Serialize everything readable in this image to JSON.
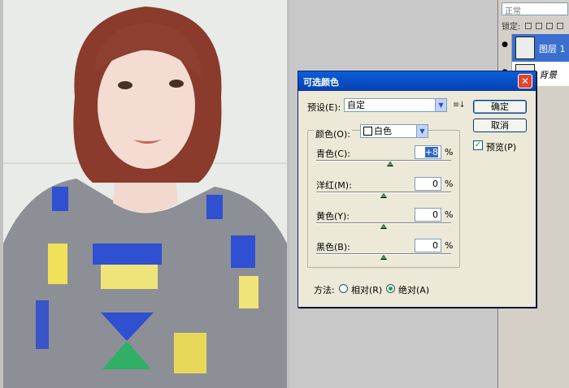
{
  "layers_panel": {
    "blend_mode": "正常",
    "lock_label": "锁定:",
    "layers": [
      {
        "name": "图层 1",
        "selected": true
      },
      {
        "name": "背景",
        "selected": false
      }
    ]
  },
  "dialog": {
    "title": "可选颜色",
    "close_glyph": "✕",
    "preset_label": "预设(E):",
    "preset_value": "自定",
    "ok_label": "确定",
    "cancel_label": "取消",
    "preview_label": "预览(P)",
    "preview_checked": true,
    "colors_label": "颜色(O):",
    "colors_value": "白色",
    "sliders": [
      {
        "label": "青色(C):",
        "value": "+8",
        "unit": "%"
      },
      {
        "label": "洋红(M):",
        "value": "0",
        "unit": "%"
      },
      {
        "label": "黄色(Y):",
        "value": "0",
        "unit": "%"
      },
      {
        "label": "黑色(B):",
        "value": "0",
        "unit": "%"
      }
    ],
    "method_label": "方法:",
    "method_options": [
      {
        "label": "相对(R)",
        "selected": false
      },
      {
        "label": "绝对(A)",
        "selected": true
      }
    ]
  },
  "colors": {
    "titlebar": "#0a52d0",
    "selected_layer": "#3a6fd0",
    "dialog_bg": "#ece9d8"
  }
}
